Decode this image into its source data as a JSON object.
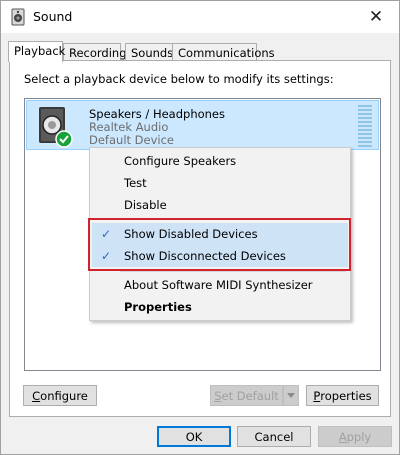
{
  "window": {
    "title": "Sound",
    "close_label": "✕"
  },
  "tabs": [
    {
      "label": "Playback",
      "active": true
    },
    {
      "label": "Recording",
      "active": false
    },
    {
      "label": "Sounds",
      "active": false
    },
    {
      "label": "Communications",
      "active": false
    }
  ],
  "panel": {
    "instruction": "Select a playback device below to modify its settings:"
  },
  "device": {
    "name": "Speakers / Headphones",
    "driver": "Realtek Audio",
    "status": "Default Device",
    "icon": "speaker-icon",
    "badge_icon": "check-badge-icon",
    "level_fraction": 0
  },
  "context_menu": {
    "items": [
      {
        "label": "Configure Speakers",
        "checked": false,
        "bold": false
      },
      {
        "label": "Test",
        "checked": false,
        "bold": false
      },
      {
        "label": "Disable",
        "checked": false,
        "bold": false
      },
      {
        "label": "Show Disabled Devices",
        "checked": true,
        "bold": false
      },
      {
        "label": "Show Disconnected Devices",
        "checked": true,
        "bold": false
      },
      {
        "label": "About Software MIDI Synthesizer",
        "checked": false,
        "bold": false
      },
      {
        "label": "Properties",
        "checked": false,
        "bold": true
      }
    ],
    "check_glyph": "✓",
    "highlight_color": "#d1232e"
  },
  "panel_buttons": {
    "configure": {
      "underline": "C",
      "rest": "onfigure"
    },
    "set_default": {
      "underline": "S",
      "rest": "et Default",
      "disabled": true
    },
    "properties": {
      "underline": "P",
      "rest": "roperties"
    }
  },
  "footer_buttons": {
    "ok": "OK",
    "cancel": "Cancel",
    "apply": {
      "underline": "A",
      "rest": "pply",
      "disabled": true
    }
  },
  "colors": {
    "selection_bg": "#cce8ff",
    "selection_border": "#99d1ff",
    "check_badge": "#17a339",
    "accent": "#0078d7"
  }
}
